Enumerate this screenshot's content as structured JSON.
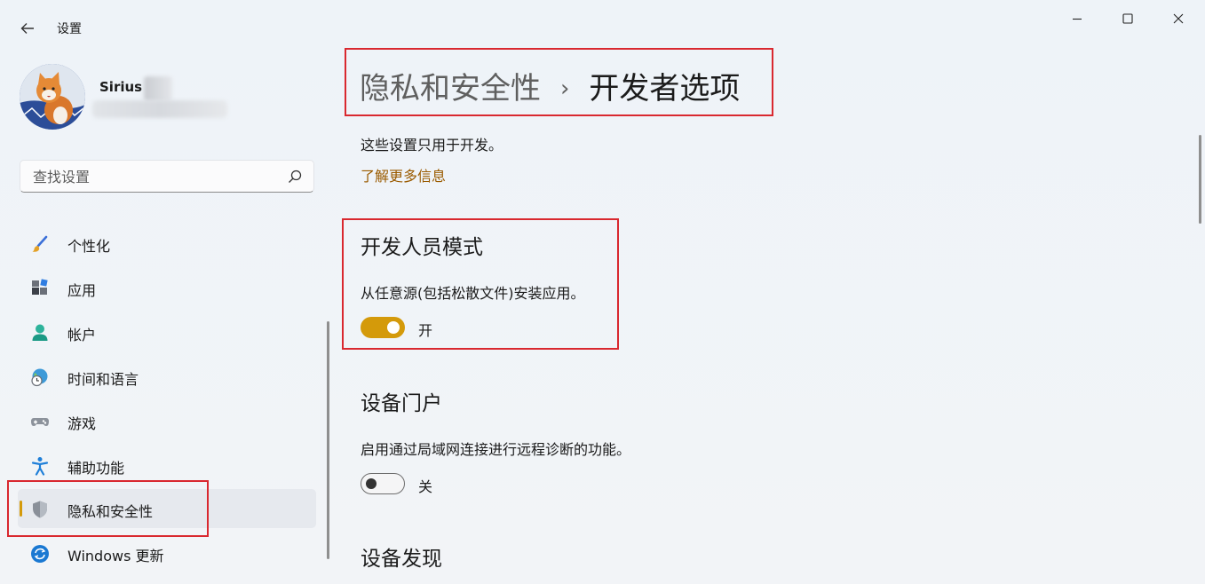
{
  "app": {
    "title": "设置"
  },
  "profile": {
    "name": "Sirius"
  },
  "search": {
    "placeholder": "查找设置"
  },
  "nav": {
    "items": [
      {
        "label": "个性化",
        "icon": "paint-brush-icon"
      },
      {
        "label": "应用",
        "icon": "apps-icon"
      },
      {
        "label": "帐户",
        "icon": "person-icon"
      },
      {
        "label": "时间和语言",
        "icon": "globe-clock-icon"
      },
      {
        "label": "游戏",
        "icon": "gamepad-icon"
      },
      {
        "label": "辅助功能",
        "icon": "accessibility-icon"
      },
      {
        "label": "隐私和安全性",
        "icon": "shield-icon",
        "selected": true
      },
      {
        "label": "Windows 更新",
        "icon": "refresh-icon"
      }
    ]
  },
  "page": {
    "breadcrumb_parent": "隐私和安全性",
    "breadcrumb_separator": "›",
    "title": "开发者选项",
    "description": "这些设置只用于开发。",
    "learn_more": "了解更多信息"
  },
  "sections": {
    "dev_mode": {
      "title": "开发人员模式",
      "desc": "从任意源(包括松散文件)安装应用。",
      "toggle_state": "开",
      "on": true
    },
    "device_portal": {
      "title": "设备门户",
      "desc": "启用通过局域网连接进行远程诊断的功能。",
      "toggle_state": "关",
      "on": false
    },
    "device_discovery": {
      "title": "设备发现"
    }
  },
  "colors": {
    "accent": "#d49a0a",
    "highlight_box": "#d9282f",
    "link": "#9a5b00"
  }
}
